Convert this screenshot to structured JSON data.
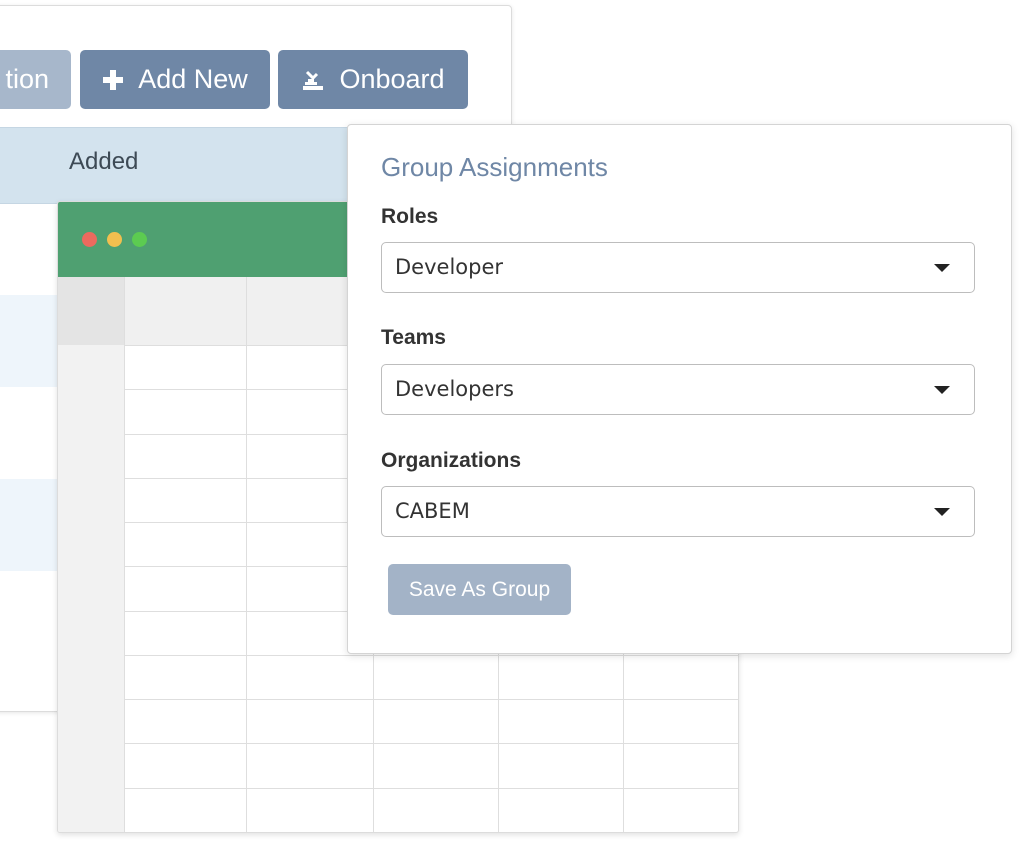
{
  "toolbar": {
    "action_label": "tion",
    "add_label": "Add New",
    "add_icon": "plus-icon",
    "onboard_label": "Onboard",
    "onboard_icon": "onboard-icon",
    "button_color": "#6f87a6",
    "button_disabled_color": "#a7b7cb"
  },
  "table": {
    "columns": [
      "Added"
    ],
    "header_color": "#d3e3ee"
  },
  "sheet_window": {
    "titlebar_color": "#4fa071",
    "window_controls": [
      "close-dot",
      "minimize-dot",
      "maximize-dot"
    ]
  },
  "group_assignments": {
    "title": "Group Assignments",
    "fields": [
      {
        "label": "Roles",
        "value": "Developer"
      },
      {
        "label": "Teams",
        "value": "Developers"
      },
      {
        "label": "Organizations",
        "value": "CABEM"
      }
    ],
    "save_label": "Save As Group",
    "accent_color": "#6f87a6"
  }
}
